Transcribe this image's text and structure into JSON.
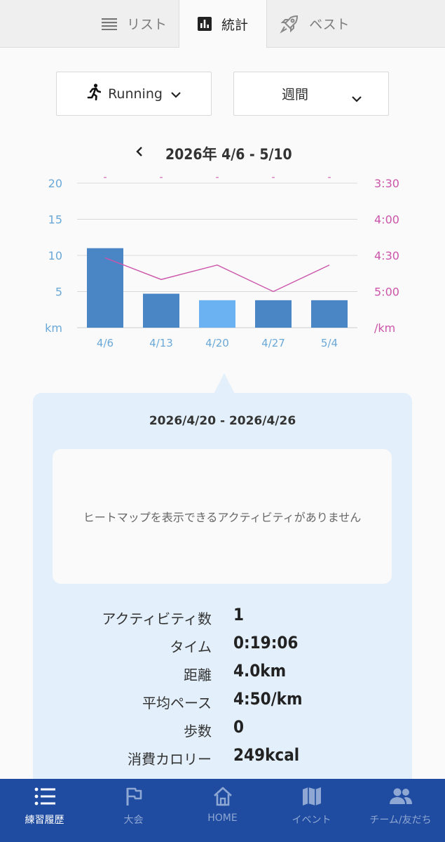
{
  "tabs": [
    {
      "label": "リスト",
      "icon": "list-icon",
      "active": false
    },
    {
      "label": "統計",
      "icon": "bar-chart-icon",
      "active": true
    },
    {
      "label": "ベスト",
      "icon": "rocket-icon",
      "active": false
    }
  ],
  "filters": {
    "activity": {
      "label": "Running",
      "icon": "runner-icon"
    },
    "period": {
      "label": "週間"
    }
  },
  "date_range": {
    "title": "2026年 4/6 - 5/10"
  },
  "chart_data": {
    "type": "bar",
    "categories": [
      "4/6",
      "4/13",
      "4/20",
      "4/27",
      "5/4"
    ],
    "series": [
      {
        "values": [
          11.0,
          4.7,
          3.8,
          3.8,
          3.8
        ],
        "axis": "left",
        "unit": "km",
        "color": "#4a86c5",
        "highlight_color": "#6ab2f2",
        "selected_index": 2
      },
      {
        "values": [
          "4:32",
          "4:50",
          "4:38",
          "5:00",
          "4:38"
        ],
        "axis": "right",
        "type": "line",
        "unit": "/km",
        "color": "#cc55aa"
      }
    ],
    "left_axis": {
      "ticks": [
        "20",
        "15",
        "10",
        "5",
        "km"
      ],
      "ylim": [
        0,
        20
      ]
    },
    "right_axis": {
      "ticks": [
        "3:30",
        "4:00",
        "4:30",
        "5:00",
        "/km"
      ],
      "ylim": [
        "5:30",
        "3:30"
      ]
    },
    "top_markers": [
      "-",
      "-",
      "-",
      "-",
      "-"
    ],
    "grid": true
  },
  "detail": {
    "range": "2026/4/20 - 2026/4/26",
    "heatmap_message": "ヒートマップを表示できるアクティビティがありません",
    "stats": [
      {
        "label": "アクティビティ数",
        "value": "1"
      },
      {
        "label": "タイム",
        "value": "0:19:06"
      },
      {
        "label": "距離",
        "value": "4.0km"
      },
      {
        "label": "平均ペース",
        "value": "4:50/km"
      },
      {
        "label": "歩数",
        "value": "0"
      },
      {
        "label": "消費カロリー",
        "value": "249kcal"
      }
    ]
  },
  "bottom_nav": [
    {
      "label": "練習履歴",
      "icon": "list-icon",
      "active": true
    },
    {
      "label": "大会",
      "icon": "flag-icon",
      "active": false
    },
    {
      "label": "HOME",
      "icon": "home-icon",
      "active": false
    },
    {
      "label": "イベント",
      "icon": "map-icon",
      "active": false
    },
    {
      "label": "チーム/友だち",
      "icon": "people-icon",
      "active": false
    }
  ],
  "colors": {
    "accent": "#1f4ca0",
    "left_axis": "#6aa8d8",
    "right_axis": "#cc55aa",
    "card_bg": "#e3f0fb"
  }
}
